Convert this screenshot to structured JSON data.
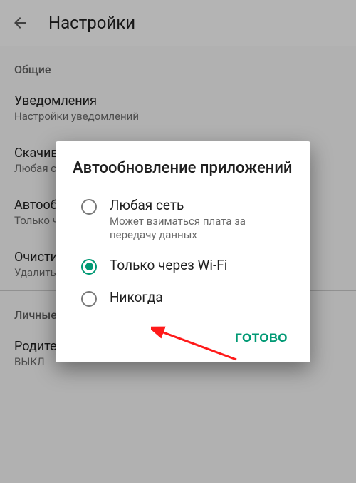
{
  "header": {
    "title": "Настройки"
  },
  "sections": {
    "general": {
      "label": "Общие"
    },
    "personal": {
      "label": "Личные"
    }
  },
  "items": {
    "notifications": {
      "title": "Уведомления",
      "sub": "Настройки уведомлений"
    },
    "downloads": {
      "title": "Скачивание приложений",
      "sub": "Любая сеть"
    },
    "autoupdate_setting": {
      "title": "Автообновление приложений",
      "sub": "Только через Wi-Fi"
    },
    "clear_history": {
      "title": "Очистить историю поиска",
      "sub": "Удалить все поисковые запросы с этого устройства"
    },
    "parental": {
      "title": "Родительский контроль",
      "sub": "ВЫКЛ"
    }
  },
  "dialog": {
    "title": "Автообновление приложений",
    "options": {
      "any": {
        "label": "Любая сеть",
        "sub": "Может взиматься плата за передачу данных"
      },
      "wifi": {
        "label": "Только через Wi-Fi"
      },
      "never": {
        "label": "Никогда"
      }
    },
    "done": "ГОТОВО"
  }
}
